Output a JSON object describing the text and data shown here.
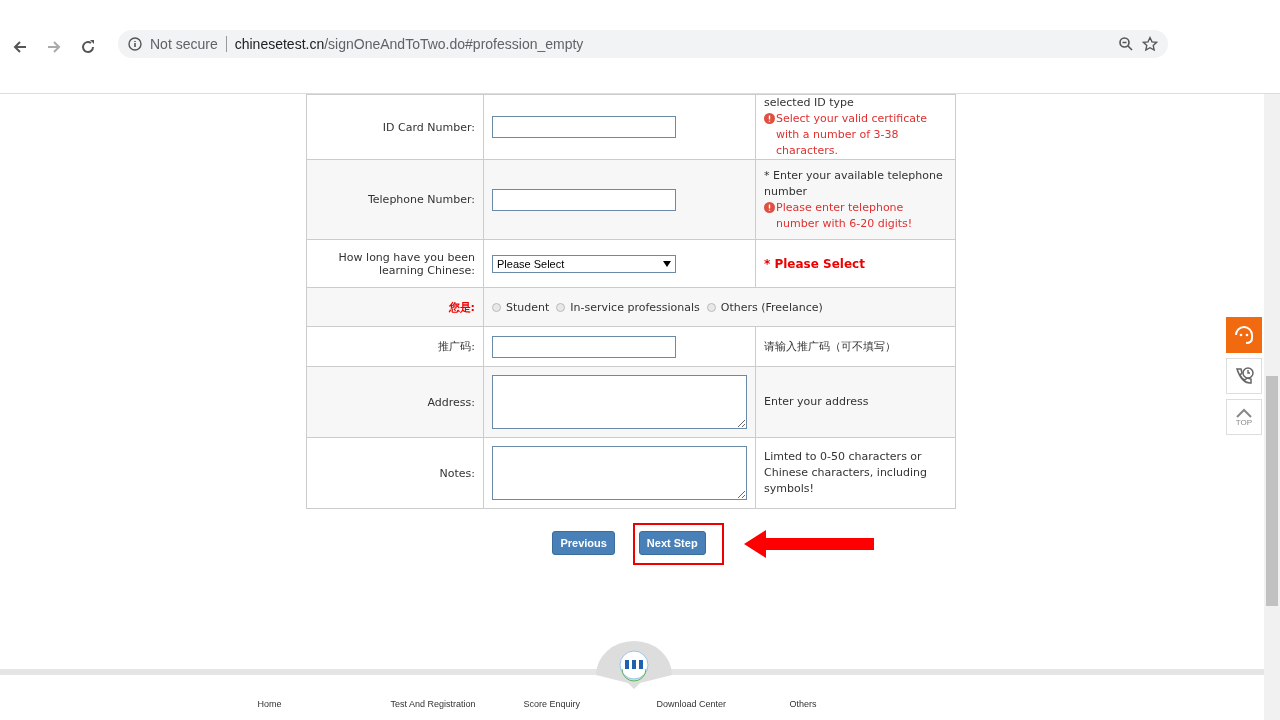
{
  "browser": {
    "security": "Not secure",
    "url_host": "chinesetest.cn",
    "url_path": "/signOneAndToTwo.do#profession_empty"
  },
  "form": {
    "rows": [
      {
        "kind": "input",
        "label": "ID Card Number:",
        "alert_label": false,
        "hints": [
          {
            "kind": "note",
            "text": "selected ID type"
          },
          {
            "kind": "error",
            "text": "Select your valid certificate with a number of 3-38 characters."
          }
        ]
      },
      {
        "kind": "input",
        "label": "Telephone Number:",
        "alert_label": false,
        "hints": [
          {
            "kind": "note",
            "text": "* Enter your available telephone number"
          },
          {
            "kind": "error",
            "text": "Please enter telephone number with 6-20 digits!"
          }
        ]
      },
      {
        "kind": "select",
        "label": "How long have you been learning Chinese:",
        "alert_label": false,
        "value": "Please Select",
        "hints": [
          {
            "kind": "alert",
            "text": "* Please Select"
          }
        ]
      },
      {
        "kind": "radio",
        "label": "您是:",
        "alert_label": true,
        "options": [
          {
            "label": "Student",
            "selected": false
          },
          {
            "label": "In-service professionals",
            "selected": false
          },
          {
            "label": "Others (Freelance)",
            "selected": false
          }
        ]
      },
      {
        "kind": "input",
        "label": "推广码:",
        "alert_label": false,
        "hints": [
          {
            "kind": "note",
            "text": "请输入推广码（可不填写）"
          }
        ]
      },
      {
        "kind": "textarea",
        "label": "Address:",
        "alert_label": false,
        "hints": [
          {
            "kind": "note",
            "text": "Enter your address"
          }
        ]
      },
      {
        "kind": "textarea",
        "label": "Notes:",
        "alert_label": false,
        "hints": [
          {
            "kind": "note",
            "text": "Limted to 0-50 characters or Chinese characters, including symbols!"
          }
        ]
      }
    ]
  },
  "buttons": [
    {
      "label": "Previous",
      "highlighted": false
    },
    {
      "label": "Next Step",
      "highlighted": true
    }
  ],
  "footer_nav": [
    "Home",
    "Test And Registration",
    "Score Enquiry",
    "Download Center",
    "Others"
  ],
  "side_tools": [
    {
      "kind": "service"
    },
    {
      "kind": "phone"
    },
    {
      "kind": "top",
      "label": "TOP"
    }
  ]
}
